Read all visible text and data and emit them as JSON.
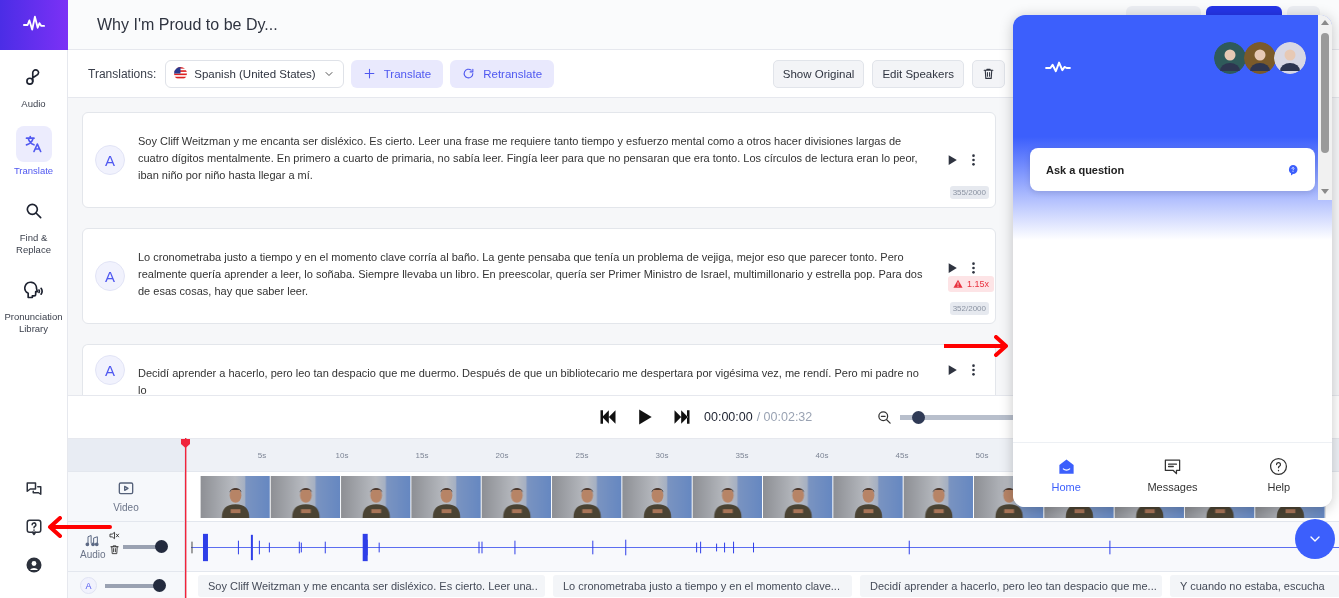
{
  "app": {
    "title": "Why I'm Proud to be Dy..."
  },
  "sidebar": {
    "items": [
      {
        "kind": "audio",
        "label": "Audio",
        "selected": false
      },
      {
        "kind": "translate",
        "label": "Translate",
        "selected": true
      },
      {
        "kind": "search",
        "label": "Find & Replace",
        "selected": false
      },
      {
        "kind": "pronunciation",
        "label": "Pronunciation Library",
        "selected": false
      }
    ],
    "bottom_icons": [
      {
        "kind": "chat"
      },
      {
        "kind": "help"
      },
      {
        "kind": "account"
      }
    ]
  },
  "toolbar": {
    "label": "Translations:",
    "language": "Spanish (United States)",
    "actions": [
      {
        "kind": "add",
        "label": "Translate"
      },
      {
        "kind": "refresh",
        "label": "Retranslate"
      }
    ],
    "tools": [
      {
        "kind": "text",
        "label": "Show Original"
      },
      {
        "kind": "text",
        "label": "Edit Speakers"
      },
      {
        "kind": "delete"
      }
    ]
  },
  "segments": [
    {
      "speaker": "A",
      "text": "Soy Cliff Weitzman y me encanta ser disléxico. Es cierto. Leer una frase me requiere tanto tiempo y esfuerzo mental como a otros hacer divisiones largas de cuatro dígitos mentalmente. En primero a cuarto de primaria, no sabía leer. Fingía leer para que no pensaran que era tonto. Los círculos de lectura eran lo peor, iban niño por niño hasta llegar a mí.",
      "count": "355/2000"
    },
    {
      "speaker": "A",
      "text": "Lo cronometraba justo a tiempo y en el momento clave corría al baño. La gente pensaba que tenía un problema de vejiga, mejor eso que parecer tonto. Pero realmente quería aprender a leer, lo soñaba. Siempre llevaba un libro. En preescolar, quería ser Primer Ministro de Israel, multimillonario y estrella pop. Para dos de esas cosas, hay que saber leer.",
      "count": "352/2000",
      "warning": "1.15x"
    },
    {
      "speaker": "A",
      "text": "Decidí aprender a hacerlo, pero leo tan despacio que me duermo. Después de que un bibliotecario me despertara por vigésima vez, me rendí. Pero mi padre no lo"
    }
  ],
  "player": {
    "time": "00:00:00",
    "duration": "/ 00:02:32",
    "zoom": {
      "level": 0.08
    }
  },
  "timeline": {
    "ticks": [
      "5s",
      "10s",
      "15s",
      "20s",
      "25s",
      "30s",
      "35s",
      "40s",
      "45s",
      "50s"
    ],
    "tracks": [
      {
        "kind": "video",
        "label": "Video"
      },
      {
        "kind": "audio",
        "label": "Audio",
        "level": 1
      },
      {
        "kind": "subtitles",
        "speaker": "A",
        "level": 1,
        "clips": [
          "Soy Cliff Weitzman y me encanta ser disléxico. Es cierto. Leer una..",
          "Lo cronometraba justo a tiempo y en el momento clave...",
          "Decidí aprender a hacerlo, pero leo tan despacio que me...",
          "Y cuando no estaba, escucha"
        ]
      }
    ]
  },
  "chat": {
    "ask": "Ask a question",
    "tabs": [
      {
        "kind": "home",
        "label": "Home",
        "selected": true
      },
      {
        "kind": "messages",
        "label": "Messages",
        "selected": false
      },
      {
        "kind": "help",
        "label": "Help",
        "selected": false
      }
    ]
  }
}
